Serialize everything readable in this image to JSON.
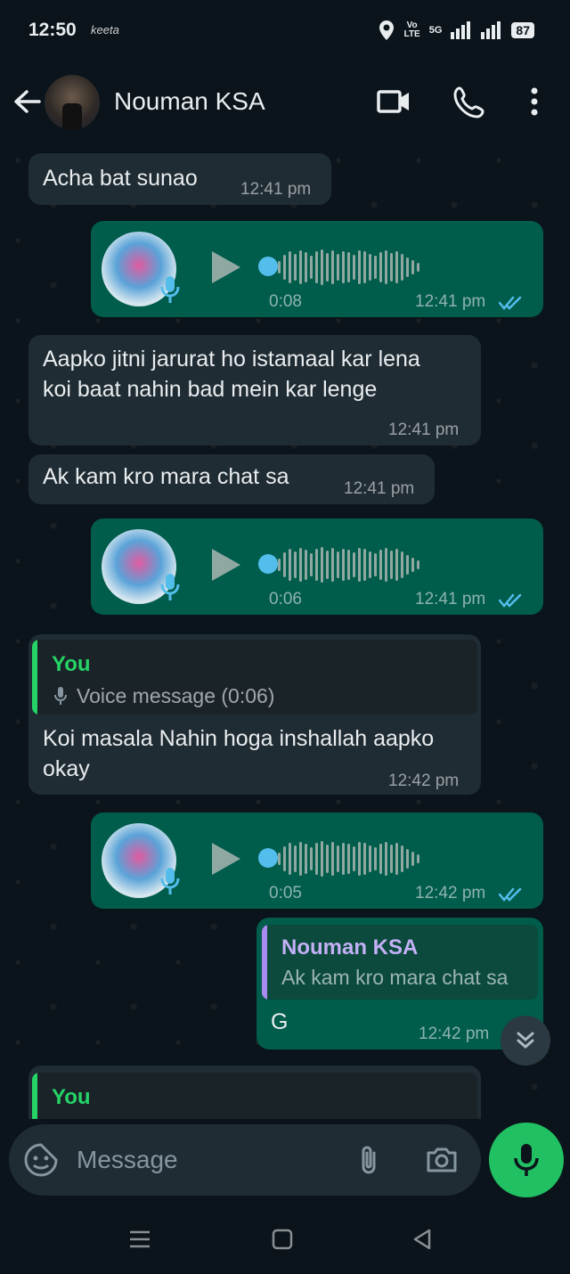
{
  "status_bar": {
    "time": "12:50",
    "app_indicator": "keeta",
    "network_top": "Vo",
    "network_bottom": "LTE",
    "network_gen": "5G",
    "battery": "87"
  },
  "header": {
    "contact_name": "Nouman KSA"
  },
  "messages": [
    {
      "direction": "in",
      "text": "Acha bat sunao",
      "time": "12:41 pm"
    },
    {
      "direction": "out",
      "type": "voice",
      "duration": "0:08",
      "time": "12:41 pm"
    },
    {
      "direction": "in",
      "text": "Aapko jitni jarurat ho istamaal kar lena koi baat nahin bad mein kar lenge",
      "time": "12:41 pm"
    },
    {
      "direction": "in",
      "text": "Ak kam kro mara chat sa",
      "time": "12:41 pm"
    },
    {
      "direction": "out",
      "type": "voice",
      "duration": "0:06",
      "time": "12:41 pm"
    },
    {
      "direction": "in",
      "quote_name": "You",
      "quote_text": "Voice message (0:06)",
      "text": "Koi masala Nahin hoga inshallah aapko okay",
      "time": "12:42 pm"
    },
    {
      "direction": "out",
      "type": "voice",
      "duration": "0:05",
      "time": "12:42 pm"
    },
    {
      "direction": "out",
      "quote_name": "Nouman KSA",
      "quote_text": "Ak kam kro mara chat sa",
      "text": "G",
      "time": "12:42 pm"
    },
    {
      "direction": "in",
      "quote_name": "You"
    }
  ],
  "composer": {
    "placeholder": "Message"
  },
  "colors": {
    "background": "#0b141a",
    "incoming_bubble": "#202c33",
    "outgoing_bubble": "#005c4b",
    "accent_green": "#21c063",
    "read_tick": "#53bdeb",
    "quote_you": "#25d366",
    "quote_contact": "#a98bf0"
  }
}
